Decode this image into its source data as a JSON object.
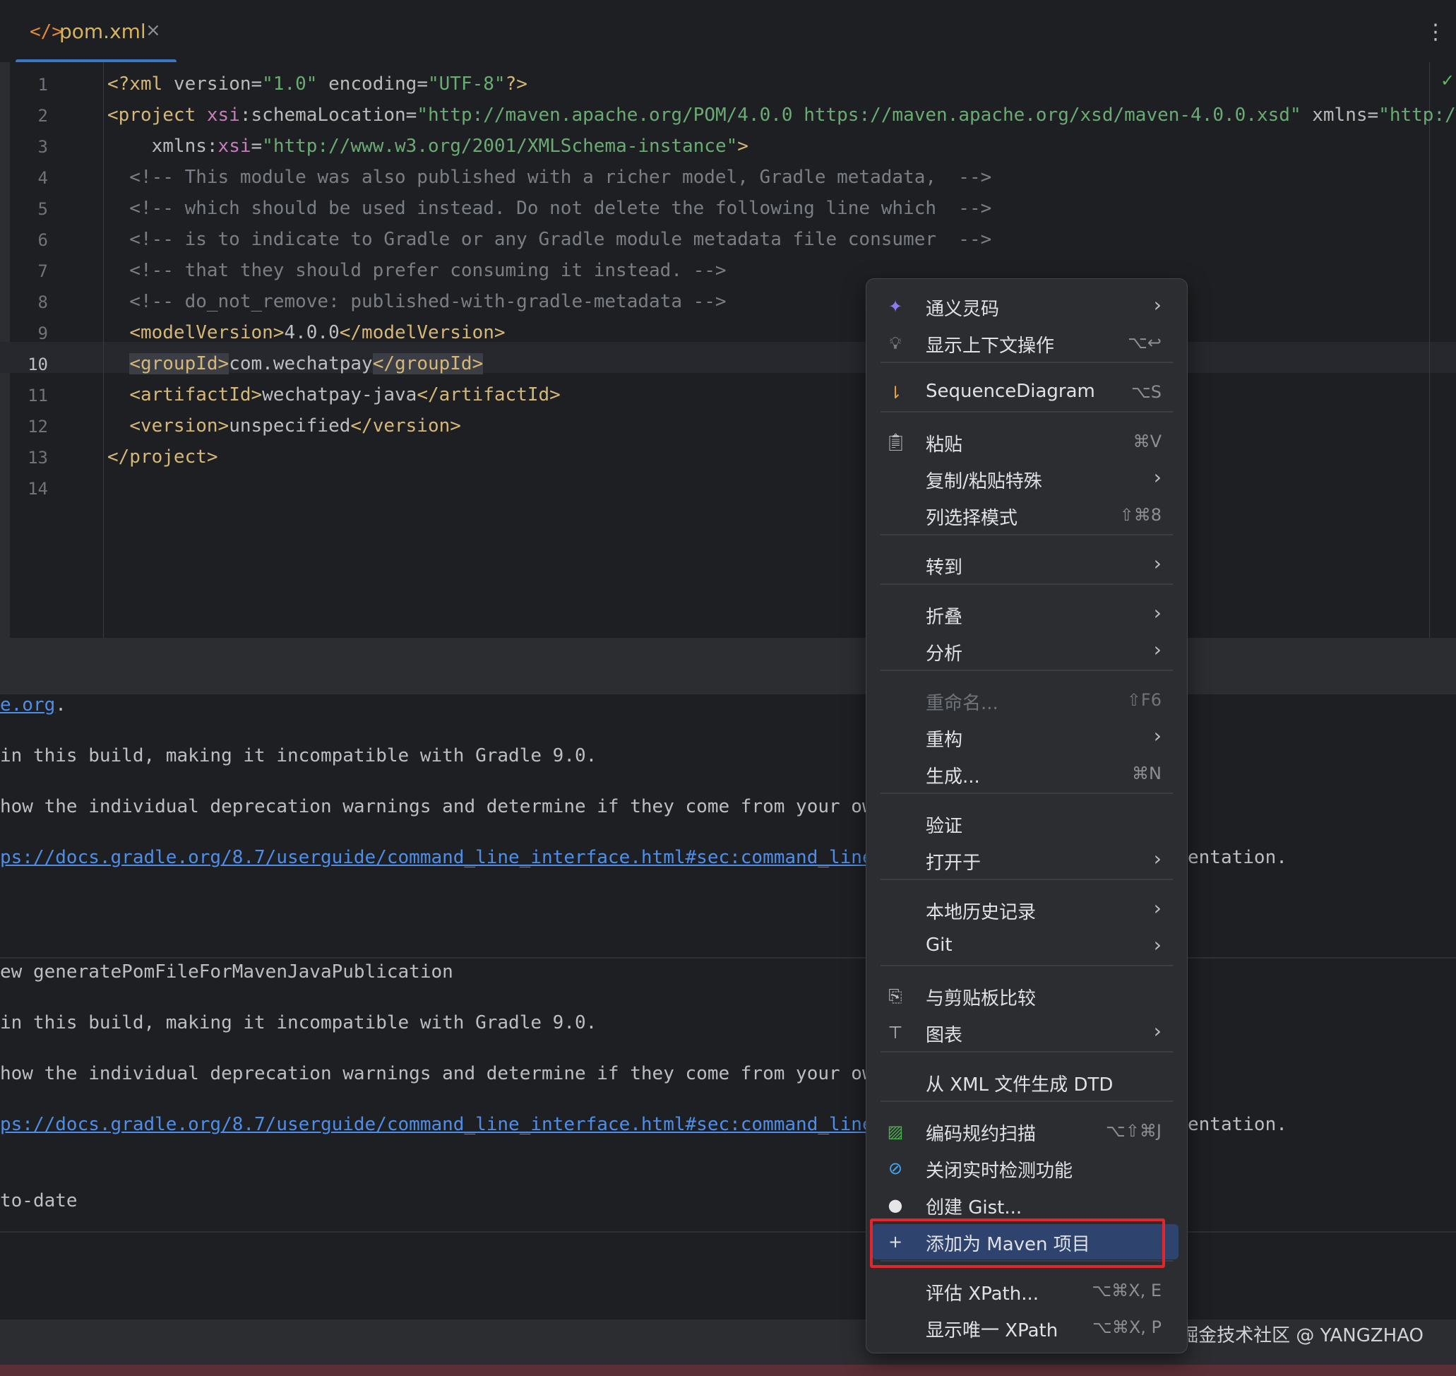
{
  "tab": {
    "icon": "xml-file-icon",
    "icon_glyph": "</>",
    "filename": "pom.xml",
    "close": "×"
  },
  "toolbar": {
    "more": "⋮",
    "inspection": "✓"
  },
  "editor": {
    "current_line": 10,
    "lines": [
      {
        "n": "1",
        "parts": [
          [
            "tag",
            "<?xml "
          ],
          [
            "attr",
            "version"
          ],
          [
            "txt",
            "="
          ],
          [
            "val",
            "\"1.0\""
          ],
          [
            "txt",
            " "
          ],
          [
            "attr",
            "encoding"
          ],
          [
            "txt",
            "="
          ],
          [
            "val",
            "\"UTF-8\""
          ],
          [
            "tag",
            "?>"
          ]
        ]
      },
      {
        "n": "2",
        "parts": [
          [
            "tag",
            "<project "
          ],
          [
            "ns",
            "xsi"
          ],
          [
            "attr",
            ":schemaLocation"
          ],
          [
            "txt",
            "="
          ],
          [
            "val",
            "\"http://maven.apache.org/POM/4.0.0 https://maven.apache.org/xsd/maven-4.0.0.xsd\""
          ],
          [
            "txt",
            " "
          ],
          [
            "attr",
            "xmlns"
          ],
          [
            "txt",
            "="
          ],
          [
            "val",
            "\"http://"
          ]
        ]
      },
      {
        "n": "3",
        "parts": [
          [
            "txt",
            "    "
          ],
          [
            "attr",
            "xmlns:"
          ],
          [
            "ns",
            "xsi"
          ],
          [
            "txt",
            "="
          ],
          [
            "val",
            "\"http://www.w3.org/2001/XMLSchema-instance\""
          ],
          [
            "tag",
            ">"
          ]
        ]
      },
      {
        "n": "4",
        "parts": [
          [
            "cmt",
            "  <!-- This module was also published with a richer model, Gradle metadata,  -->"
          ]
        ]
      },
      {
        "n": "5",
        "parts": [
          [
            "cmt",
            "  <!-- which should be used instead. Do not delete the following line which  -->"
          ]
        ]
      },
      {
        "n": "6",
        "parts": [
          [
            "cmt",
            "  <!-- is to indicate to Gradle or any Gradle module metadata file consumer  -->"
          ]
        ]
      },
      {
        "n": "7",
        "parts": [
          [
            "cmt",
            "  <!-- that they should prefer consuming it instead. -->"
          ]
        ]
      },
      {
        "n": "8",
        "parts": [
          [
            "cmt",
            "  <!-- do_not_remove: published-with-gradle-metadata -->"
          ]
        ]
      },
      {
        "n": "9",
        "parts": [
          [
            "txt",
            "  "
          ],
          [
            "tag",
            "<modelVersion>"
          ],
          [
            "txt",
            "4.0.0"
          ],
          [
            "tag",
            "</modelVersion>"
          ]
        ]
      },
      {
        "n": "10",
        "parts": [
          [
            "txt",
            "  "
          ],
          [
            "taghl",
            "<groupId>"
          ],
          [
            "txt",
            "com.wechatpay"
          ],
          [
            "taghl",
            "</groupId>"
          ]
        ]
      },
      {
        "n": "11",
        "parts": [
          [
            "txt",
            "  "
          ],
          [
            "tag",
            "<artifactId>"
          ],
          [
            "txt",
            "wechatpay-java"
          ],
          [
            "tag",
            "</artifactId>"
          ]
        ]
      },
      {
        "n": "12",
        "parts": [
          [
            "txt",
            "  "
          ],
          [
            "tag",
            "<version>"
          ],
          [
            "txt",
            "unspecified"
          ],
          [
            "tag",
            "</version>"
          ]
        ]
      },
      {
        "n": "13",
        "parts": [
          [
            "tag",
            "</project>"
          ]
        ]
      },
      {
        "n": "14",
        "parts": []
      }
    ]
  },
  "console": {
    "lines": [
      {
        "pre_link": "",
        "link": "e.org",
        "post": "."
      },
      {
        "text": "in this build, making it incompatible with Gradle 9.0."
      },
      {
        "text": "how the individual deprecation warnings and determine if they come from your ow"
      },
      {
        "pre_link": "",
        "link": "ps://docs.gradle.org/8.7/userguide/command_line_interface.html#sec:command_line",
        "post": "",
        "tail": "entation."
      },
      {
        "text": "ew generatePomFileForMavenJavaPublication"
      },
      {
        "text": "in this build, making it incompatible with Gradle 9.0."
      },
      {
        "text": "how the individual deprecation warnings and determine if they come from your ow"
      },
      {
        "pre_link": "",
        "link": "ps://docs.gradle.org/8.7/userguide/command_line_interface.html#sec:command_line",
        "post": "",
        "tail": "entation."
      },
      {
        "text": "to-date"
      }
    ]
  },
  "menu": {
    "items": [
      {
        "icon": "tongyi-lingma-icon",
        "glyph": "✦",
        "icon_color": "#8a7cf2",
        "label": "通义灵码",
        "shortcut": "",
        "submenu": true
      },
      {
        "icon": "lightbulb-icon",
        "glyph": "💡︎",
        "icon_color": "#bcbec4",
        "label": "显示上下文操作",
        "shortcut": "⌥↩",
        "submenu": false
      },
      {
        "icon": "sequence-diagram-icon",
        "glyph": "⇂",
        "icon_color": "#e8a33a",
        "label": "SequenceDiagram",
        "shortcut": "⌥S",
        "submenu": false
      },
      {
        "icon": "clipboard-icon",
        "glyph": "📋︎",
        "icon_color": "#bcbec4",
        "label": "粘贴",
        "shortcut": "⌘V",
        "submenu": false
      },
      {
        "icon": "",
        "glyph": "",
        "label": "复制/粘贴特殊",
        "shortcut": "",
        "submenu": true
      },
      {
        "icon": "",
        "glyph": "",
        "label": "列选择模式",
        "shortcut": "⇧⌘8",
        "submenu": false
      },
      {
        "icon": "",
        "glyph": "",
        "label": "转到",
        "shortcut": "",
        "submenu": true
      },
      {
        "icon": "",
        "glyph": "",
        "label": "折叠",
        "shortcut": "",
        "submenu": true
      },
      {
        "icon": "",
        "glyph": "",
        "label": "分析",
        "shortcut": "",
        "submenu": true
      },
      {
        "icon": "",
        "glyph": "",
        "label": "重命名...",
        "shortcut": "⇧F6",
        "submenu": false,
        "disabled": true
      },
      {
        "icon": "",
        "glyph": "",
        "label": "重构",
        "shortcut": "",
        "submenu": true
      },
      {
        "icon": "",
        "glyph": "",
        "label": "生成...",
        "shortcut": "⌘N",
        "submenu": false
      },
      {
        "icon": "",
        "glyph": "",
        "label": "验证",
        "shortcut": "",
        "submenu": false
      },
      {
        "icon": "",
        "glyph": "",
        "label": "打开于",
        "shortcut": "",
        "submenu": true
      },
      {
        "icon": "",
        "glyph": "",
        "label": "本地历史记录",
        "shortcut": "",
        "submenu": true
      },
      {
        "icon": "",
        "glyph": "",
        "label": "Git",
        "shortcut": "",
        "submenu": true
      },
      {
        "icon": "compare-clipboard-icon",
        "glyph": "⎘",
        "icon_color": "#bcbec4",
        "label": "与剪贴板比较",
        "shortcut": "",
        "submenu": false
      },
      {
        "icon": "diagram-icon",
        "glyph": "⊤",
        "icon_color": "#bcbec4",
        "label": "图表",
        "shortcut": "",
        "submenu": true
      },
      {
        "icon": "",
        "glyph": "",
        "label": "从 XML 文件生成 DTD",
        "shortcut": "",
        "submenu": false
      },
      {
        "icon": "code-scan-icon",
        "glyph": "▨",
        "icon_color": "#4caf50",
        "label": "编码规约扫描",
        "shortcut": "⌥⇧⌘J",
        "submenu": false
      },
      {
        "icon": "disable-realtime-icon",
        "glyph": "⊘",
        "icon_color": "#3fa9f5",
        "label": "关闭实时检测功能",
        "shortcut": "",
        "submenu": false
      },
      {
        "icon": "github-icon",
        "glyph": "●",
        "icon_color": "#e6e6e6",
        "label": "创建 Gist...",
        "shortcut": "",
        "submenu": false
      },
      {
        "icon": "plus-icon",
        "glyph": "+",
        "icon_color": "#dfe1e5",
        "label": "添加为 Maven 项目",
        "shortcut": "",
        "submenu": false,
        "selected": true
      },
      {
        "icon": "",
        "glyph": "",
        "label": "评估 XPath...",
        "shortcut": "⌥⌘X, E",
        "submenu": false
      },
      {
        "icon": "",
        "glyph": "",
        "label": "显示唯一 XPath",
        "shortcut": "⌥⌘X, P",
        "submenu": false
      }
    ]
  },
  "watermark": "掘金技术社区 @ YANGZHAO"
}
